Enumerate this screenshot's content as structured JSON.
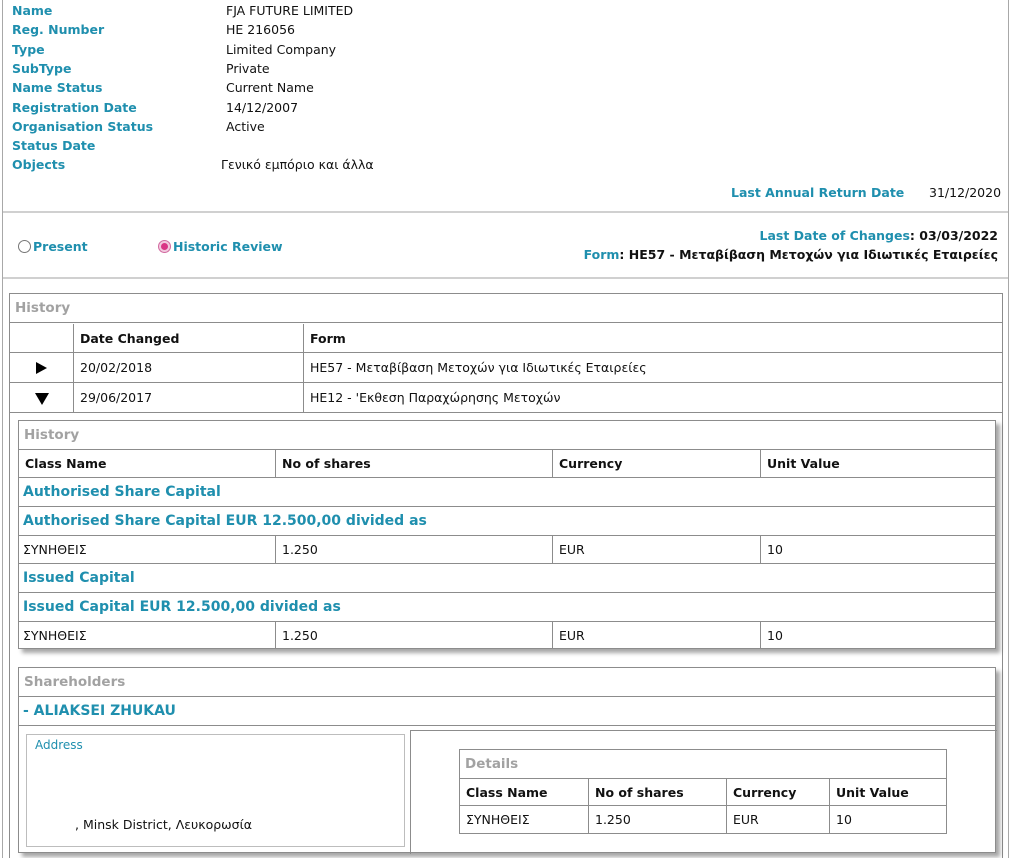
{
  "company": {
    "fields": [
      {
        "label": "Name",
        "value": "FJA FUTURE LIMITED"
      },
      {
        "label": "Reg. Number",
        "value": "HE 216056"
      },
      {
        "label": "Type",
        "value": "Limited Company"
      },
      {
        "label": "SubType",
        "value": "Private"
      },
      {
        "label": "Name Status",
        "value": "Current Name"
      },
      {
        "label": "Registration Date",
        "value": "14/12/2007"
      },
      {
        "label": "Organisation Status",
        "value": "Active"
      },
      {
        "label": "Status Date",
        "value": ""
      },
      {
        "label": "Objects",
        "value": "Γενικό εμπόριο και άλλα"
      }
    ],
    "last_annual_return_label": "Last Annual Return Date",
    "last_annual_return_value": "31/12/2020"
  },
  "review": {
    "present_label": "Present",
    "historic_label": "Historic Review",
    "selected": "historic",
    "last_changes_label": "Last Date of Changes",
    "last_changes_value": "03/03/2022",
    "form_label": "Form",
    "form_value": "HE57 - Μεταβίβαση Μετοχών για Ιδιωτικές Εταιρείες"
  },
  "history": {
    "title": "History",
    "headers": [
      "Date Changed",
      "Form"
    ],
    "rows": [
      {
        "date": "20/02/2018",
        "form": "HE57 - Μεταβίβαση Μετοχών για Ιδιωτικές Εταιρείες",
        "expanded": false
      },
      {
        "date": "29/06/2017",
        "form": "HE12 - 'Εκθεση Παραχώρησης Μετοχών",
        "expanded": true
      }
    ]
  },
  "capital": {
    "title": "History",
    "headers": [
      "Class Name",
      "No of shares",
      "Currency",
      "Unit Value"
    ],
    "authorised_heading": "Authorised Share Capital",
    "authorised_summary": "Authorised Share Capital EUR 12.500,00 divided as",
    "authorised_row": [
      "ΣΥΝΗΘΕΙΣ",
      "1.250",
      "EUR",
      "10"
    ],
    "issued_heading": "Issued Capital",
    "issued_summary": "Issued Capital EUR 12.500,00 divided as",
    "issued_row": [
      "ΣΥΝΗΘΕΙΣ",
      "1.250",
      "EUR",
      "10"
    ]
  },
  "shareholders": {
    "title": "Shareholders",
    "name": "- ALIAKSEI ZHUKAU",
    "address_label": "Address",
    "address_value": ", Minsk District, Λευκορωσία",
    "details_title": "Details",
    "details_headers": [
      "Class Name",
      "No of shares",
      "Currency",
      "Unit Value"
    ],
    "details_row": [
      "ΣΥΝΗΘΕΙΣ",
      "1.250",
      "EUR",
      "10"
    ]
  }
}
